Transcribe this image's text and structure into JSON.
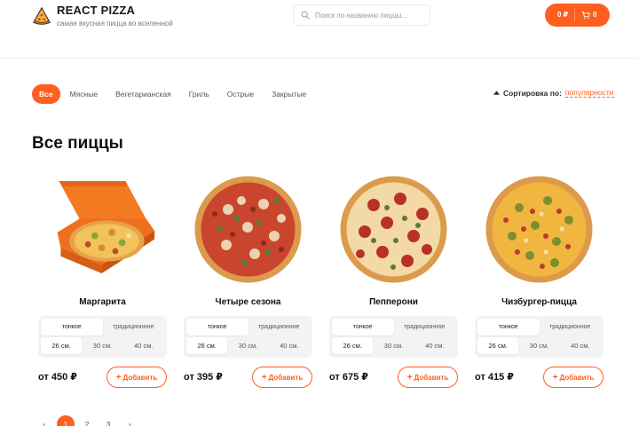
{
  "header": {
    "title": "REACT PIZZA",
    "subtitle": "самая вкусная пицца во вселенной",
    "search_placeholder": "Поиск по названию пиццы...",
    "cart_price": "0 ₽",
    "cart_count": "0"
  },
  "categories": {
    "items": [
      "Все",
      "Мясные",
      "Вегетарианская",
      "Гриль",
      "Острые",
      "Закрытые"
    ],
    "active_index": 0
  },
  "sort": {
    "label": "Сортировка по:",
    "value": "популярности"
  },
  "section_title": "Все пиццы",
  "pizzas": [
    {
      "name": "Маргарита",
      "price": "от 450 ₽",
      "types": [
        "тонкое",
        "традиционное"
      ],
      "sizes": [
        "26 см.",
        "30 см.",
        "40 см."
      ],
      "add_label": "Добавить"
    },
    {
      "name": "Четыре сезона",
      "price": "от 395 ₽",
      "types": [
        "тонкое",
        "традиционное"
      ],
      "sizes": [
        "26 см.",
        "30 см.",
        "40 см."
      ],
      "add_label": "Добавить"
    },
    {
      "name": "Пепперони",
      "price": "от 675 ₽",
      "types": [
        "тонкое",
        "традиционное"
      ],
      "sizes": [
        "26 см.",
        "30 см.",
        "40 см."
      ],
      "add_label": "Добавить"
    },
    {
      "name": "Чизбургер-пицца",
      "price": "от 415 ₽",
      "types": [
        "тонкое",
        "традиционное"
      ],
      "sizes": [
        "26 см.",
        "30 см.",
        "40 см."
      ],
      "add_label": "Добавить"
    }
  ],
  "pagination": {
    "prev": "‹",
    "pages": [
      "1",
      "2",
      "3"
    ],
    "next": "›",
    "active": "1"
  },
  "colors": {
    "accent": "#fe5f1e",
    "text": "#181818"
  },
  "icons": {
    "logo": "pizza-slice-icon",
    "search": "search-icon",
    "cart": "cart-icon",
    "sort": "caret-up-icon"
  }
}
